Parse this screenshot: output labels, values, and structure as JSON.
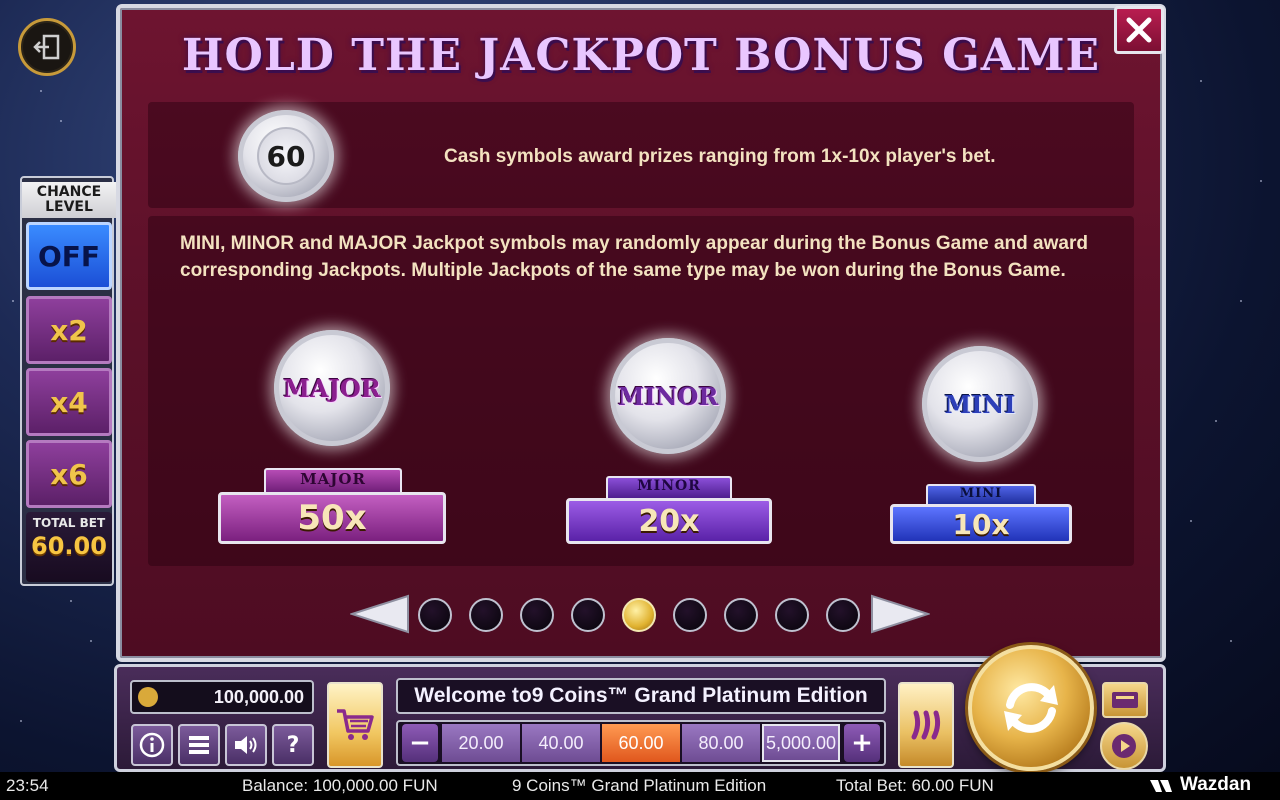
{
  "panel": {
    "title": "HOLD THE JACKPOT BONUS GAME",
    "cash_coin_value": "60",
    "cash_text": "Cash symbols award prizes ranging from 1x-10x player's bet.",
    "description": "MINI, MINOR and MAJOR Jackpot symbols may randomly appear during the Bonus Game and award corresponding Jackpots. Multiple Jackpots of the same type may be won during the Bonus Game.",
    "jackpots": [
      {
        "coin_label": "MAJOR",
        "tag": "MAJOR",
        "value": "50x"
      },
      {
        "coin_label": "MINOR",
        "tag": "MINOR",
        "value": "20x"
      },
      {
        "coin_label": "MINI",
        "tag": "MINI",
        "value": "10x"
      }
    ],
    "pagination": {
      "total": 9,
      "active_index": 4
    }
  },
  "chance_level": {
    "title": "CHANCE LEVEL",
    "off_label": "OFF",
    "options": [
      "x2",
      "x4",
      "x6"
    ],
    "total_bet_label": "TOTAL BET",
    "total_bet_value": "60.00"
  },
  "controls": {
    "balance": "100,000.00",
    "welcome": "Welcome to9 Coins™ Grand Platinum Edition",
    "bet_options": [
      "20.00",
      "40.00",
      "60.00",
      "80.00",
      "5,000.00"
    ],
    "selected_bet_index": 2,
    "minus": "−",
    "plus": "+",
    "help": "?"
  },
  "status_bar": {
    "time": "23:54",
    "balance": "Balance: 100,000.00 FUN",
    "game": "9 Coins™ Grand Platinum Edition",
    "total_bet": "Total Bet: 60.00 FUN",
    "brand": "Wazdan"
  },
  "colors": {
    "panel_bg": "#5a1028",
    "accent_gold": "#e7b44a",
    "selected_bet": "#e0571d",
    "off_blue": "#1b4fd6"
  }
}
